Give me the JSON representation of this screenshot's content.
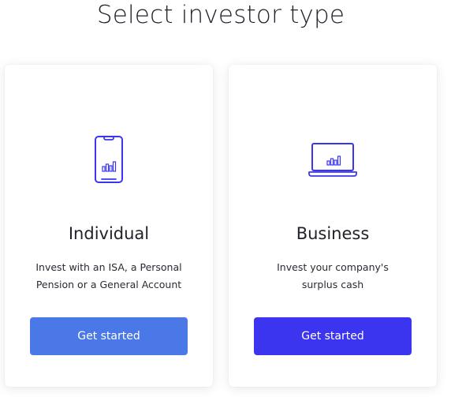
{
  "page": {
    "title": "Select investor type"
  },
  "cards": [
    {
      "icon": "smartphone-chart-icon",
      "title": "Individual",
      "description_lines": [
        "Invest with an ISA, a Personal",
        "Pension or a General Account"
      ],
      "button_label": "Get started",
      "button_color": "#4a78e6"
    },
    {
      "icon": "laptop-chart-icon",
      "title": "Business",
      "description_lines": [
        "Invest your company's",
        "surplus cash"
      ],
      "button_label": "Get started",
      "button_color": "#3b35ef"
    }
  ],
  "colors": {
    "icon_stroke": "#3b35ef",
    "text": "#22222c"
  }
}
